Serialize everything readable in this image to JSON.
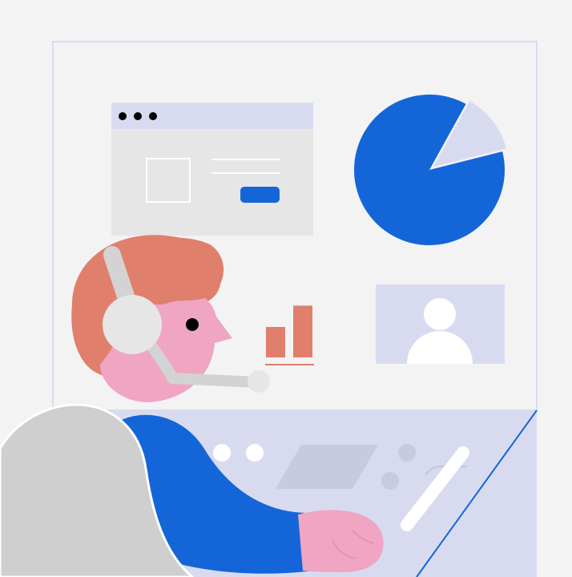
{
  "illustration": {
    "subject": "support-agent-with-headset-at-dashboard",
    "icons": [
      "browser-window-icon",
      "pie-chart-icon",
      "bar-chart-icon",
      "user-profile-icon",
      "headset-icon",
      "keyboard-icon"
    ]
  },
  "pie": {
    "main_fraction": 0.87,
    "slice_fraction": 0.13
  },
  "bars": {
    "values": [
      0.5,
      0.85
    ]
  },
  "colors": {
    "background": "#f3f3f4",
    "panel_outline": "#d6dcf2",
    "lavender": "#d8dbf0",
    "light_gray": "#e6e6e6",
    "blue": "#1466d8",
    "salmon": "#e07f6c",
    "pink": "#f0a5c3",
    "headset_gray": "#d3d3d3",
    "shoulder_gray": "#cfcfcf",
    "dark": "#000000",
    "white": "#ffffff"
  }
}
